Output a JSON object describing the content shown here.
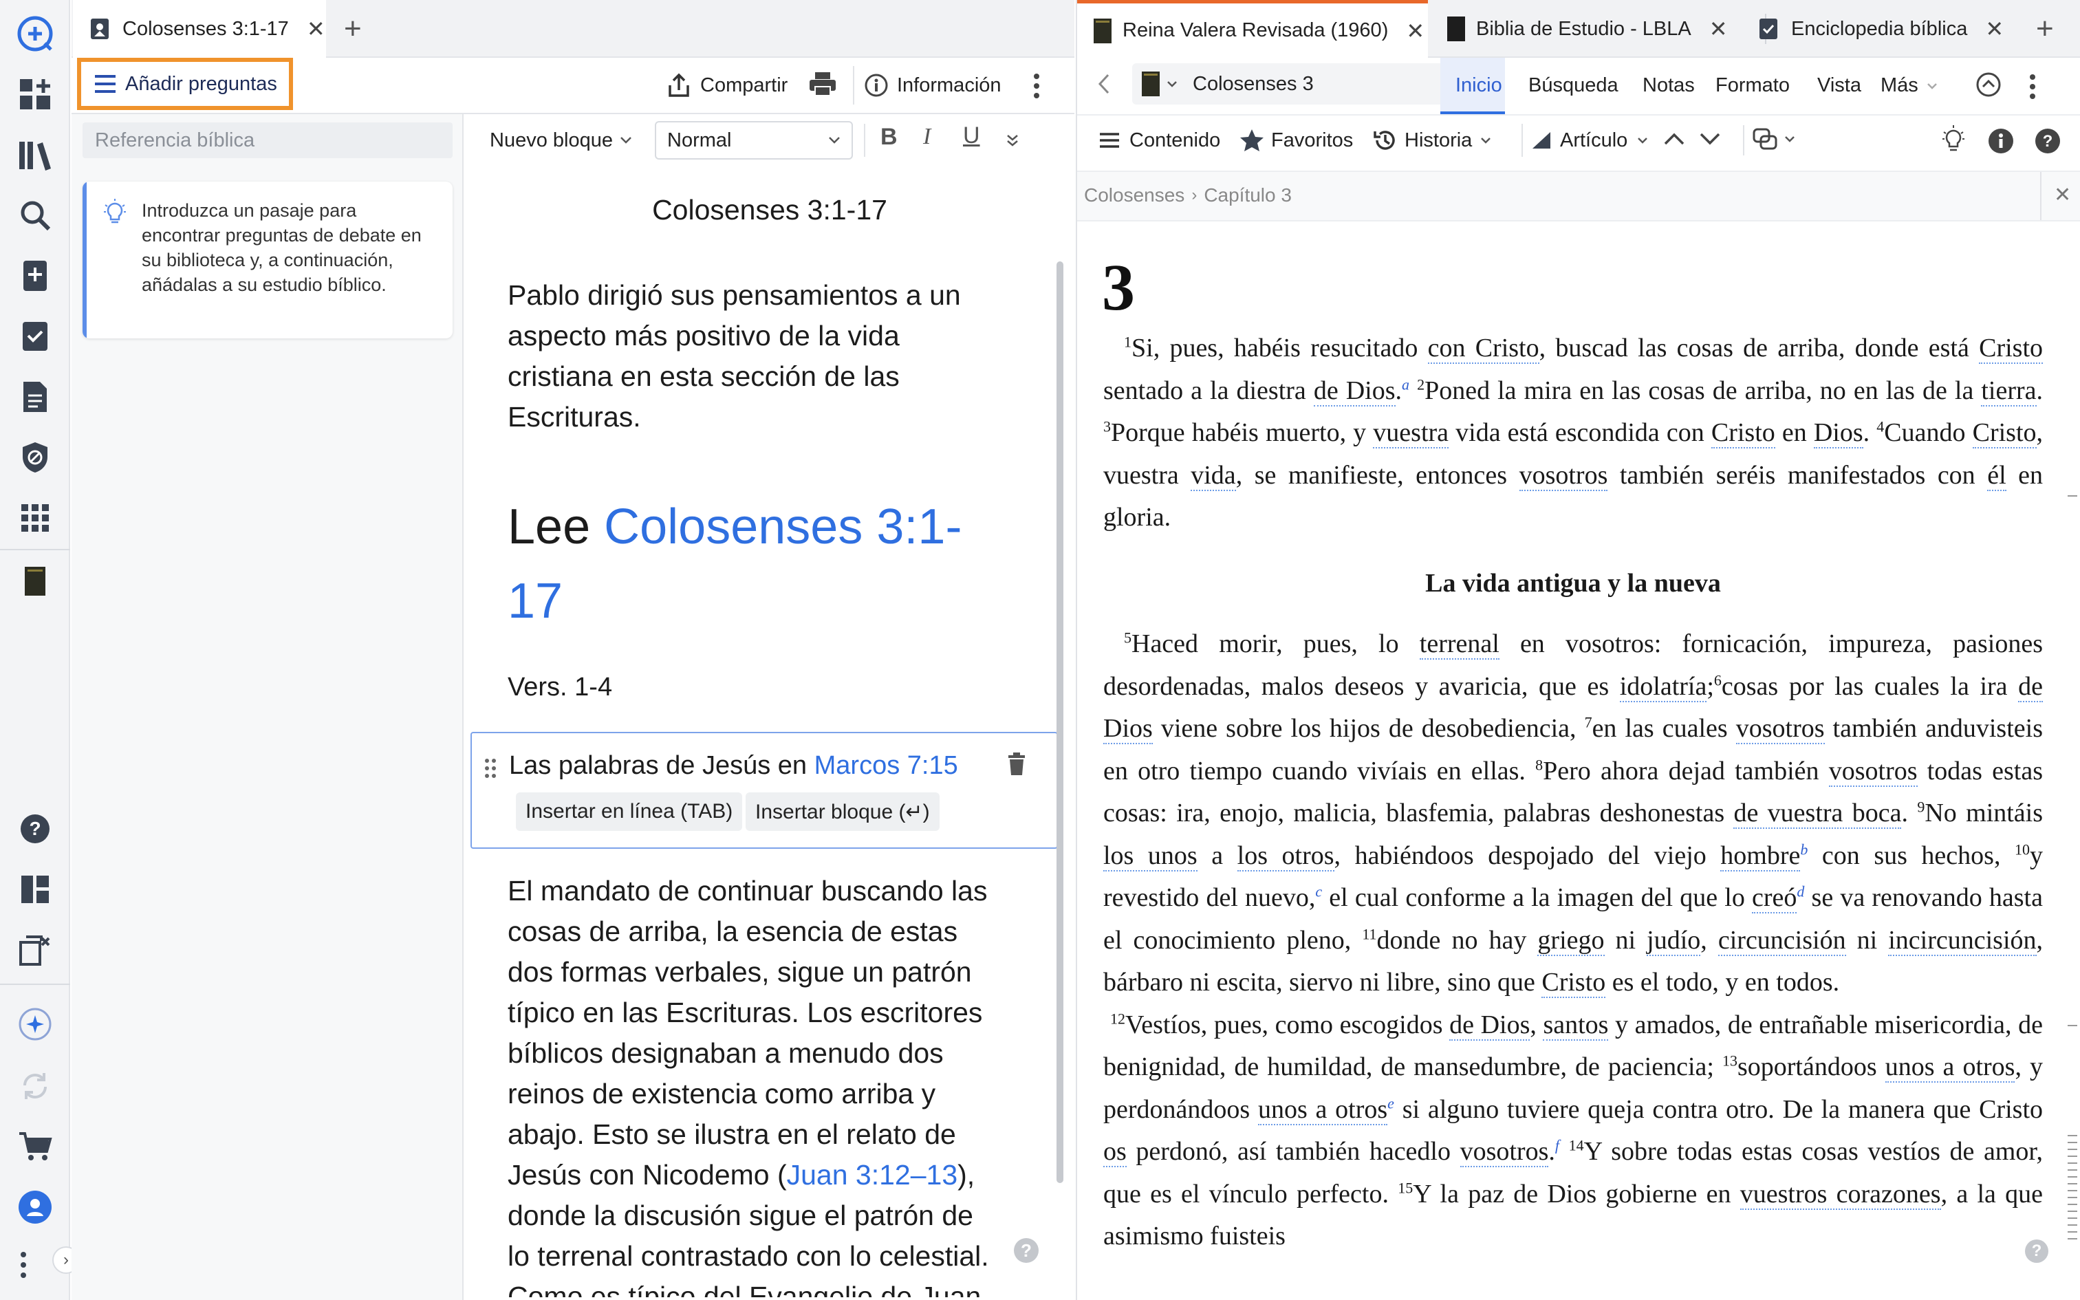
{
  "left_panel": {
    "tab_title": "Colosenses 3:1-17",
    "toolbar": {
      "add_questions": "Añadir preguntas",
      "share": "Compartir",
      "info": "Información"
    },
    "sidebar": {
      "search_placeholder": "Referencia bíblica",
      "tip": "Introduzca un pasaje para encontrar preguntas de debate en su biblioteca y, a continuación, añádalas a su estudio bíblico."
    },
    "editor_toolbar": {
      "new_block": "Nuevo bloque",
      "style": "Normal"
    },
    "doc": {
      "title": "Colosenses 3:1-17",
      "intro": "Pablo dirigió sus pensamientos a un aspecto más positivo de la vida cristiana en esta sección de las Escrituras.",
      "heading_prefix": "Lee ",
      "heading_link": "Colosenses 3:1-17",
      "verses_label": "Vers. 1-4",
      "block_text": "Las palabras de Jesús en ",
      "block_link": "Marcos 7:15",
      "insert_inline": "Insertar en línea (TAB)",
      "insert_block": "Insertar bloque (↵)",
      "body_1": "El mandato de continuar buscando las cosas de arriba, la esencia de estas dos formas verbales, sigue un patrón típico en las Escrituras. Los escritores bíblicos designaban a menudo dos reinos de existencia como arriba y abajo. Esto se ilustra en el relato de Jesús con Nicodemo (",
      "body_link": "Juan 3:12–13",
      "body_2": "), donde la discusión sigue el patrón de lo terrenal contrastado con lo celestial. Como es típico del Evangelio de Juan, Jesús"
    }
  },
  "right_panel": {
    "tabs": [
      {
        "label": "Reina Valera Revisada (1960)"
      },
      {
        "label": "Biblia de Estudio - LBLA"
      },
      {
        "label": "Enciclopedia bíblica"
      }
    ],
    "reference": "Colosenses 3",
    "menu": [
      "Inicio",
      "Búsqueda",
      "Notas",
      "Formato",
      "Vista",
      "Más"
    ],
    "toolbar": {
      "contents": "Contenido",
      "favorites": "Favoritos",
      "history": "Historia",
      "article": "Artículo"
    },
    "breadcrumb": [
      "Colosenses",
      "Capítulo 3"
    ],
    "chapter": "3",
    "section_heading": "La vida antigua y la nueva"
  },
  "colors": {
    "accent": "#2f6fe0",
    "highlight": "#f0932c",
    "active_tab": "#e8682a"
  }
}
